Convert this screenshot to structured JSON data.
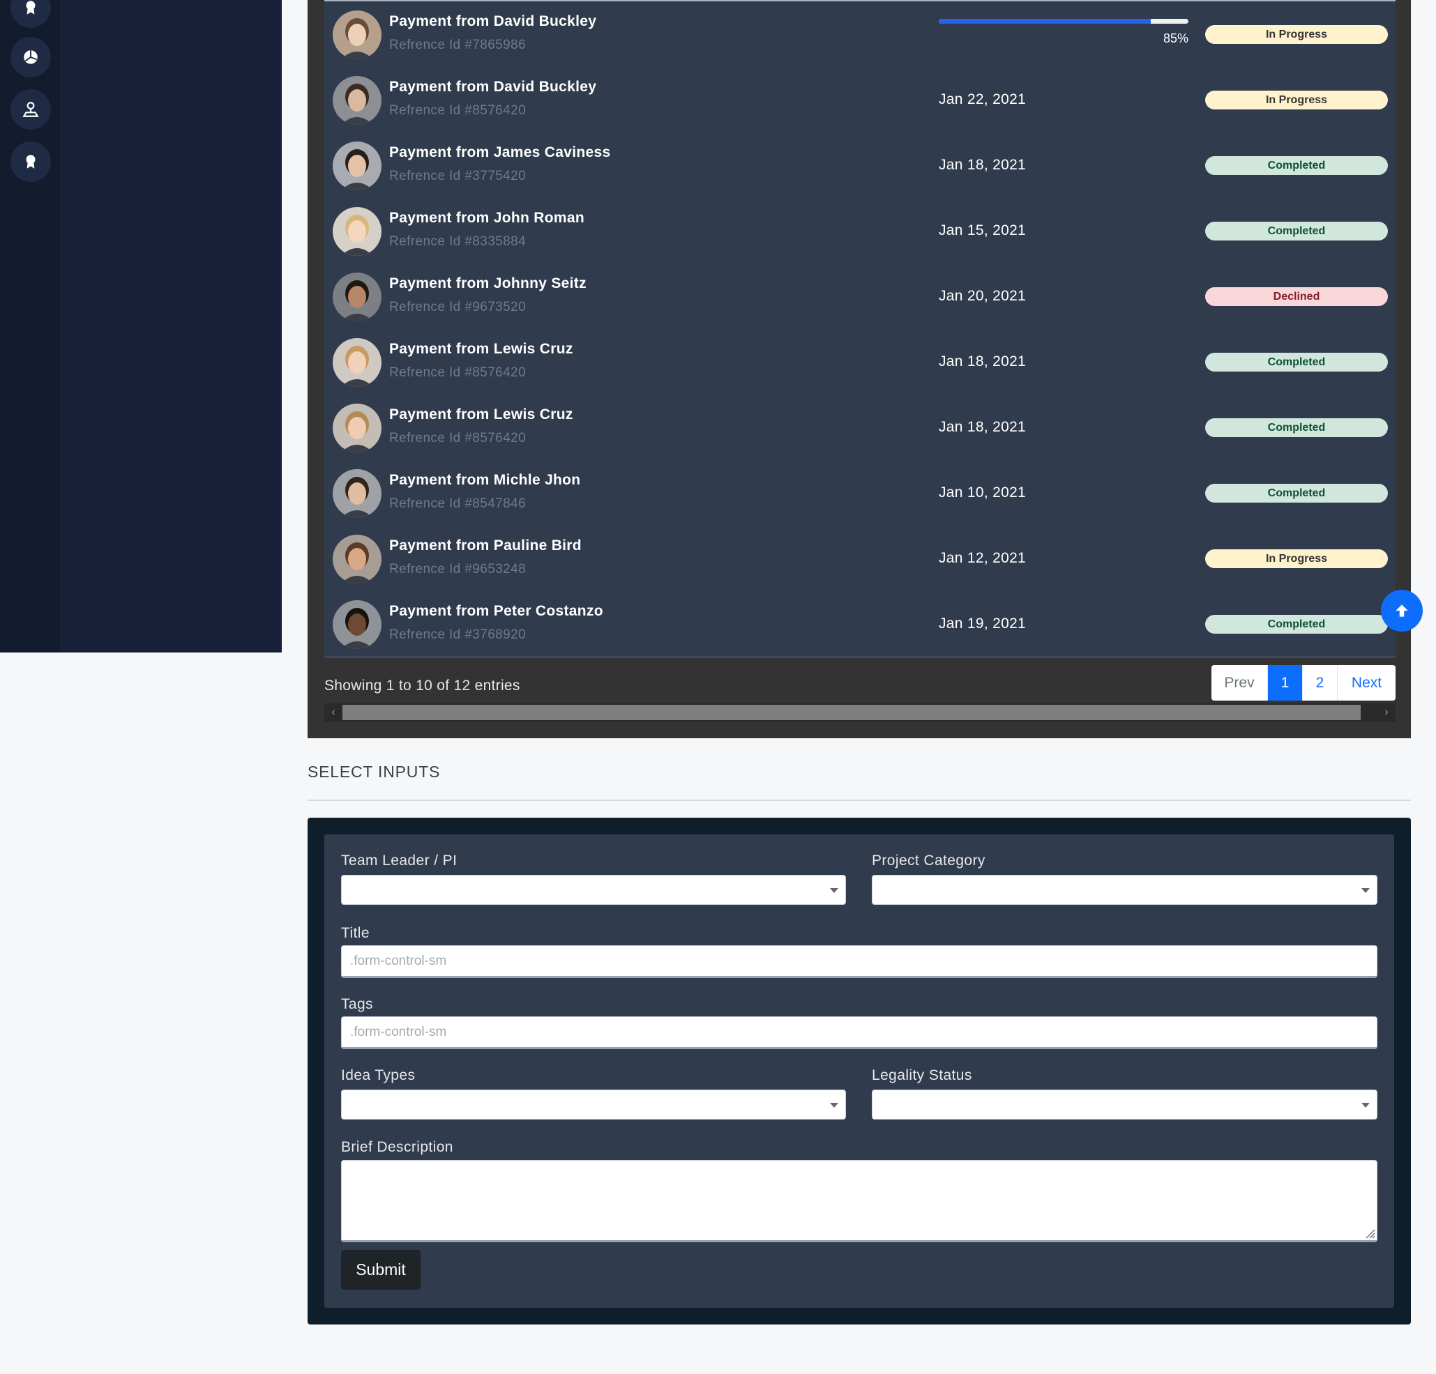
{
  "colors": {
    "sidebar": "#172036",
    "table_bg": "#303b4d",
    "primary": "#0d6efd",
    "progress_fill": "#2563eb",
    "badge_in_progress": "#fff3cd",
    "badge_completed": "#d1e7dd",
    "badge_declined": "#f8d7da"
  },
  "sidebar": {
    "icons": [
      "award-icon",
      "pie-chart-icon",
      "user-stand-icon",
      "award-icon"
    ]
  },
  "table": {
    "rows": [
      {
        "title": "Payment from David Buckley",
        "ref": "Refrence Id #7865986",
        "date": "",
        "progress": 85,
        "progress_label": "85%",
        "status": "In Progress",
        "status_type": "in-progress"
      },
      {
        "title": "Payment from David Buckley",
        "ref": "Refrence Id #8576420",
        "date": "Jan 22, 2021",
        "status": "In Progress",
        "status_type": "in-progress"
      },
      {
        "title": "Payment from James Caviness",
        "ref": "Refrence Id #3775420",
        "date": "Jan 18, 2021",
        "status": "Completed",
        "status_type": "completed"
      },
      {
        "title": "Payment from John Roman",
        "ref": "Refrence Id #8335884",
        "date": "Jan 15, 2021",
        "status": "Completed",
        "status_type": "completed"
      },
      {
        "title": "Payment from Johnny Seitz",
        "ref": "Refrence Id #9673520",
        "date": "Jan 20, 2021",
        "status": "Declined",
        "status_type": "declined"
      },
      {
        "title": "Payment from Lewis Cruz",
        "ref": "Refrence Id #8576420",
        "date": "Jan 18, 2021",
        "status": "Completed",
        "status_type": "completed"
      },
      {
        "title": "Payment from Lewis Cruz",
        "ref": "Refrence Id #8576420",
        "date": "Jan 18, 2021",
        "status": "Completed",
        "status_type": "completed"
      },
      {
        "title": "Payment from Michle Jhon",
        "ref": "Refrence Id #8547846",
        "date": "Jan 10, 2021",
        "status": "Completed",
        "status_type": "completed"
      },
      {
        "title": "Payment from Pauline Bird",
        "ref": "Refrence Id #9653248",
        "date": "Jan 12, 2021",
        "status": "In Progress",
        "status_type": "in-progress"
      },
      {
        "title": "Payment from Peter Costanzo",
        "ref": "Refrence Id #3768920",
        "date": "Jan 19, 2021",
        "status": "Completed",
        "status_type": "completed"
      }
    ],
    "entries_info": "Showing 1 to 10 of 12 entries",
    "pagination": {
      "prev": "Prev",
      "page1": "1",
      "page2": "2",
      "next": "Next",
      "active": "1"
    }
  },
  "form_section": {
    "title": "SELECT INPUTS",
    "team_leader_label": "Team Leader / PI",
    "project_category_label": "Project Category",
    "title_label": "Title",
    "title_placeholder": ".form-control-sm",
    "tags_label": "Tags",
    "tags_placeholder": ".form-control-sm",
    "idea_types_label": "Idea Types",
    "legality_status_label": "Legality Status",
    "brief_description_label": "Brief Description",
    "submit_label": "Submit"
  }
}
